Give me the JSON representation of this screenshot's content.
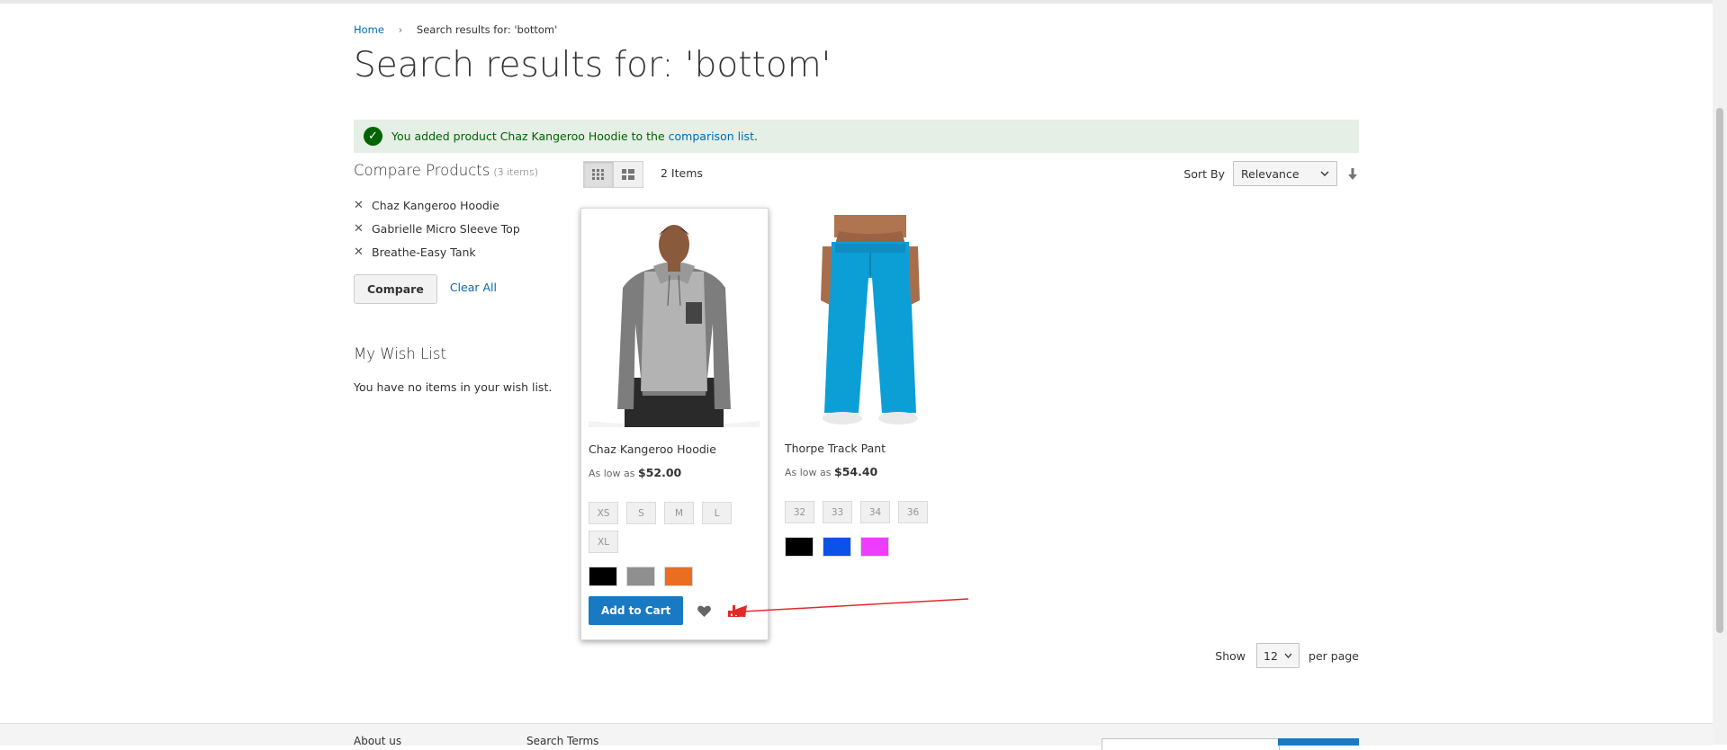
{
  "breadcrumb": {
    "home": "Home",
    "separator": "›",
    "current": "Search results for: 'bottom'"
  },
  "page_title": "Search results for: 'bottom'",
  "message": {
    "text": "You added product Chaz Kangeroo Hoodie to the",
    "link": "comparison list",
    "end": ".",
    "icon": "check-icon"
  },
  "compare": {
    "title": "Compare Products",
    "count": "(3 items)",
    "items": [
      "Chaz Kangeroo Hoodie",
      "Gabrielle Micro Sleeve Top",
      "Breathe-Easy Tank"
    ],
    "compare_label": "Compare",
    "clear_label": "Clear All"
  },
  "wishlist": {
    "title": "My Wish List",
    "empty": "You have no items in your wish list."
  },
  "toolbar": {
    "amount": "2 Items",
    "sort_label": "Sort By",
    "sort_value": "Relevance",
    "show_label": "Show",
    "limit_value": "12",
    "per_page": "per page"
  },
  "products": [
    {
      "name": "Chaz Kangeroo Hoodie",
      "price_label": "As low as",
      "price": "$52.00",
      "sizes": [
        "XS",
        "S",
        "M",
        "L",
        "XL"
      ],
      "colors": [
        "#000000",
        "#8f8f8f",
        "#eb6d21"
      ],
      "add_to_cart": "Add to Cart"
    },
    {
      "name": "Thorpe Track Pant",
      "price_label": "As low as",
      "price": "$54.40",
      "sizes": [
        "32",
        "33",
        "34",
        "36"
      ],
      "colors": [
        "#000000",
        "#0a52ea",
        "#ef3dff"
      ]
    }
  ],
  "colors": {
    "link": "#006bb4",
    "primary_button": "#1979c3",
    "success_bg": "#e5efe5",
    "success_text": "#006400",
    "annotation": "#e02b27"
  },
  "footer": {
    "link1": "About us",
    "link2": "Search Terms"
  }
}
